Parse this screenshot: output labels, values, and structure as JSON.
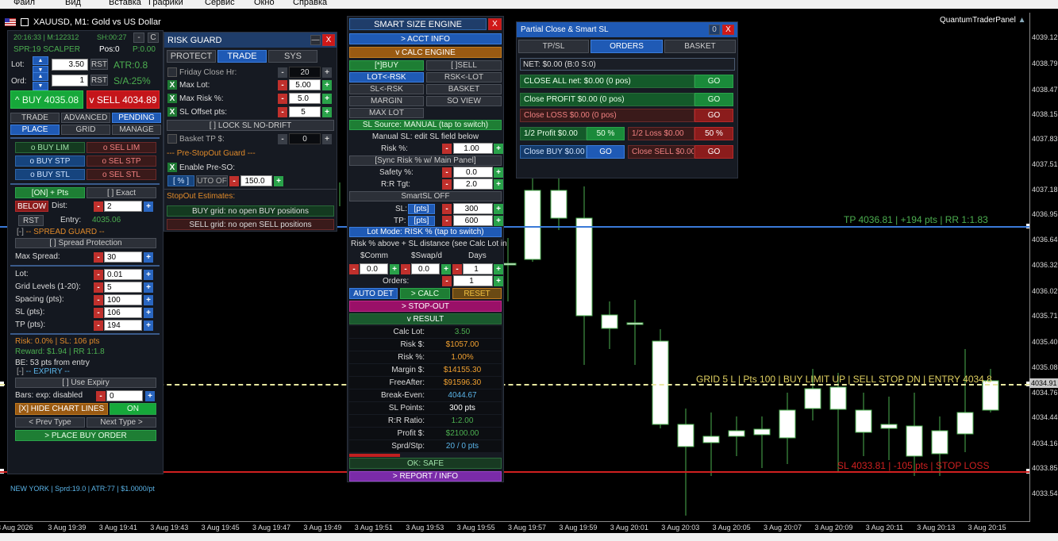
{
  "menu": [
    "Файл",
    "Вид",
    "Вставка",
    "Графики",
    "Сервис",
    "Окно",
    "Справка"
  ],
  "chart": {
    "title": "XAUUSD, M1:  Gold vs US Dollar",
    "brand": "QuantumTraderPanel",
    "y_ticks": [
      "4039.12",
      "4038.79",
      "4038.47",
      "4038.15",
      "4037.83",
      "4037.51",
      "4037.18",
      "4036.95",
      "4036.64",
      "4036.32",
      "4036.02",
      "4035.71",
      "4035.40",
      "4035.08",
      "4034.76",
      "4034.44",
      "4034.16",
      "4033.85",
      "4033.54"
    ],
    "price_tag": "4034.91",
    "x_ticks": [
      "3 Aug 2026",
      "3 Aug 19:39",
      "3 Aug 19:41",
      "3 Aug 19:43",
      "3 Aug 19:45",
      "3 Aug 19:47",
      "3 Aug 19:49",
      "3 Aug 19:51",
      "3 Aug 19:53",
      "3 Aug 19:55",
      "3 Aug 19:57",
      "3 Aug 19:59",
      "3 Aug 20:01",
      "3 Aug 20:03",
      "3 Aug 20:05",
      "3 Aug 20:07",
      "3 Aug 20:09",
      "3 Aug 20:11",
      "3 Aug 20:13",
      "3 Aug 20:15"
    ],
    "tp_label": "TP 4036.81 | +194 pts | RR 1:1.83",
    "grid_label": "GRID 5 L | Pts 100 | BUY LIMIT UP | SELL STOP DN | ENTRY 4034.8",
    "sl_label": "SL 4033.81 | -105 pts | STOP LOSS",
    "colors": {
      "tp": "#4a8ad8",
      "sl": "#d02020",
      "grid": "#e0d060",
      "candle": "#4caf50"
    }
  },
  "left": {
    "time": "20:16:33 | M:122312",
    "sh": "SH:00:27",
    "spr": "SPR:19 SCALPER",
    "pos": "Pos:0",
    "pnl": "P:0.00",
    "lot_label": "Lot:",
    "lot_value": "3.50",
    "ord_label": "Ord:",
    "ord_value": "1",
    "rst": "RST",
    "atr": "ATR:0.8",
    "sa": "S/A:25%",
    "buy": "^ BUY  4035.08",
    "sell": "v SELL  4034.89",
    "tabs1": [
      "TRADE",
      "ADVANCED",
      "PENDING"
    ],
    "tabs2": [
      "PLACE",
      "GRID",
      "MANAGE"
    ],
    "buy_lim": "o BUY LIM",
    "sel_lim": "o SEL LIM",
    "buy_stp": "o BUY STP",
    "sel_stp": "o SEL STP",
    "buy_stl": "o BUY STL",
    "sel_stl": "o SEL STL",
    "on_pts": "[ON] + Pts",
    "exact": "[ ] Exact",
    "below": "BELOW",
    "dist_label": "Dist:",
    "dist_value": "2",
    "entry_label": "Entry:",
    "entry_value": "4035.06",
    "spread_guard": "-- SPREAD GUARD --",
    "spread_prot": "[ ] Spread Protection",
    "max_spread_label": "Max Spread:",
    "max_spread": "30",
    "grid_lot_label": "Lot:",
    "grid_lot": "0.01",
    "grid_levels_label": "Grid Levels (1-20):",
    "grid_levels": "5",
    "spacing_label": "Spacing (pts):",
    "spacing": "100",
    "sl_label": "SL (pts):",
    "sl": "106",
    "tp_label": "TP (pts):",
    "tp": "194",
    "risk_line": "Risk: 0.0% | SL: 106 pts",
    "reward_line": "Reward: $1.94 | RR 1:1.8",
    "be_line": "BE: 53 pts from entry",
    "expiry": "-- EXPIRY --",
    "use_expiry": "[ ] Use Expiry",
    "bars_label": "Bars:  exp: disabled",
    "bars": "0",
    "hide_lines": "[X] HIDE CHART LINES",
    "on": "ON",
    "prev_type": "< Prev Type",
    "next_type": "Next Type >",
    "place_order": "> PLACE BUY ORDER",
    "footer": "NEW YORK | Sprd:19.0 | ATR:77 | $1.0000/pt"
  },
  "riskguard": {
    "title": "RISK GUARD",
    "tabs": [
      "PROTECT",
      "TRADE",
      "SYS"
    ],
    "friday_label": "Friday Close Hr:",
    "friday": "20",
    "max_lot_label": "Max Lot:",
    "max_lot": "5.00",
    "max_risk_label": "Max Risk %:",
    "max_risk": "5.0",
    "sl_offset_label": "SL Offset pts:",
    "sl_offset": "5",
    "lock_sl": "[ ] LOCK SL NO-DRIFT",
    "basket_label": "Basket TP $:",
    "basket": "0",
    "prestop_header": "--- Pre-StopOut Guard ---",
    "enable_pre": "Enable Pre-SO:",
    "pct": "[ % ]",
    "uto": "UTO OF",
    "uto_value": "150.0",
    "stopout_header": "StopOut Estimates:",
    "buy_grid": "BUY  grid: no open BUY positions",
    "sell_grid": "SELL grid: no open SELL positions"
  },
  "smart": {
    "title": "SMART SIZE ENGINE",
    "acct": "> ACCT INFO",
    "calc": "v CALC ENGINE",
    "mbuy": "[*]BUY",
    "isell": "[ ]SELL",
    "lot_rsk": "LOT<-RSK",
    "rsk_lot": "RSK<-LOT",
    "sl_rsk": "SL<-RSK",
    "basket": "BASKET",
    "margin": "MARGIN",
    "so_view": "SO VIEW",
    "max_lot": "MAX LOT",
    "sl_source": "SL Source: MANUAL (tap to switch)",
    "manual_sl": "Manual SL: edit SL field below",
    "risk_label": "Risk %:",
    "risk": "1.00",
    "sync": "[Sync Risk % w/ Main Panel]",
    "safety_label": "Safety %:",
    "safety": "0.0",
    "rr_label": "R:R Tgt:",
    "rr": "2.0",
    "smartsl": "SmartSL OFF",
    "sl_label": "SL:",
    "sl": "300",
    "tp_label": "TP:",
    "tp": "600",
    "pts": "[pts]",
    "lot_mode": "Lot Mode: RISK % (tap to switch)",
    "risk_note": "Risk % above + SL distance (see Calc Lot in",
    "comm_label": "$Comm",
    "swap_label": "$Swap/d",
    "days_label": "Days",
    "comm": "0.0",
    "swap": "0.0",
    "days": "1",
    "orders_label": "Orders:",
    "orders": "1",
    "auto_det": "AUTO DET",
    "calc_btn": "> CALC",
    "reset": "RESET",
    "stop_out": "> STOP-OUT",
    "result": "v RESULT",
    "results": [
      {
        "label": "Calc Lot:",
        "value": "3.50",
        "color": "#4caf50"
      },
      {
        "label": "Risk $:",
        "value": "$1057.00",
        "color": "#f0a030"
      },
      {
        "label": "Risk %:",
        "value": "1.00%",
        "color": "#f0a030"
      },
      {
        "label": "Margin $:",
        "value": "$14155.30",
        "color": "#f0a030"
      },
      {
        "label": "FreeAfter:",
        "value": "$91596.30",
        "color": "#f0a030"
      },
      {
        "label": "Break-Even:",
        "value": "4044.67",
        "color": "#5ab4e8"
      },
      {
        "label": "SL Points:",
        "value": "300 pts",
        "color": "#ffffff"
      },
      {
        "label": "R:R Ratio:",
        "value": "1:2.00",
        "color": "#4caf50"
      },
      {
        "label": "Profit $:",
        "value": "$2100.00",
        "color": "#4caf50"
      },
      {
        "label": "Sprd/Stp:",
        "value": "20 / 0 pts",
        "color": "#5ab4e8"
      }
    ],
    "ok_safe": "OK: SAFE",
    "report": "> REPORT / INFO"
  },
  "partial": {
    "title": "Partial Close & Smart SL",
    "min": "0",
    "close": "X",
    "tabs": [
      "TP/SL",
      "ORDERS",
      "BASKET"
    ],
    "net": "NET: $0.00  (B:0 S:0)",
    "close_all": "CLOSE ALL  net: $0.00  (0 pos)",
    "close_profit": "Close PROFIT  $0.00  (0 pos)",
    "close_loss": "Close LOSS    $0.00  (0 pos)",
    "go": "GO",
    "half_profit": "1/2 Profit $0.00",
    "half_loss": "1/2 Loss    $0.00",
    "pct50": "50 %",
    "close_buy": "Close BUY $0.00",
    "close_sell": "Close SELL $0.00"
  }
}
